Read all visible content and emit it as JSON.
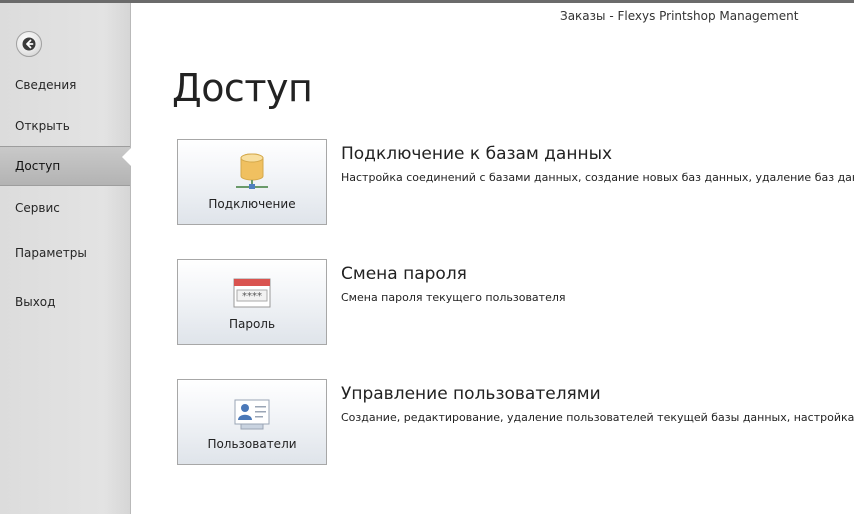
{
  "window": {
    "title": "Заказы - Flexys Printshop Management"
  },
  "sidebar": {
    "back_icon": "back-arrow-icon",
    "items": [
      {
        "label": "Сведения",
        "active": false
      },
      {
        "label": "Открыть",
        "active": false
      },
      {
        "label": "Доступ",
        "active": true
      },
      {
        "label": "Сервис",
        "active": false
      },
      {
        "label": "Параметры",
        "active": false
      },
      {
        "label": "Выход",
        "active": false
      }
    ]
  },
  "main": {
    "title": "Доступ",
    "sections": [
      {
        "button_label": "Подключение",
        "icon": "database-connection-icon",
        "title": "Подключение к базам данных",
        "description": "Настройка соединений с базами данных, создание новых баз данных, удаление баз данных"
      },
      {
        "button_label": "Пароль",
        "icon": "password-icon",
        "title": "Смена пароля",
        "description": "Смена пароля текущего пользователя"
      },
      {
        "button_label": "Пользователи",
        "icon": "users-icon",
        "title": "Управление пользователями",
        "description": "Создание, редактирование, удаление пользователей текущей базы данных, настройка прав пользователей"
      }
    ]
  },
  "colors": {
    "sidebar_bg": "#e0e0e0",
    "active_item_bg": "#bdbdbd",
    "db_icon": "#f0c060",
    "password_header": "#d9534f",
    "user_icon": "#4a78b8"
  }
}
